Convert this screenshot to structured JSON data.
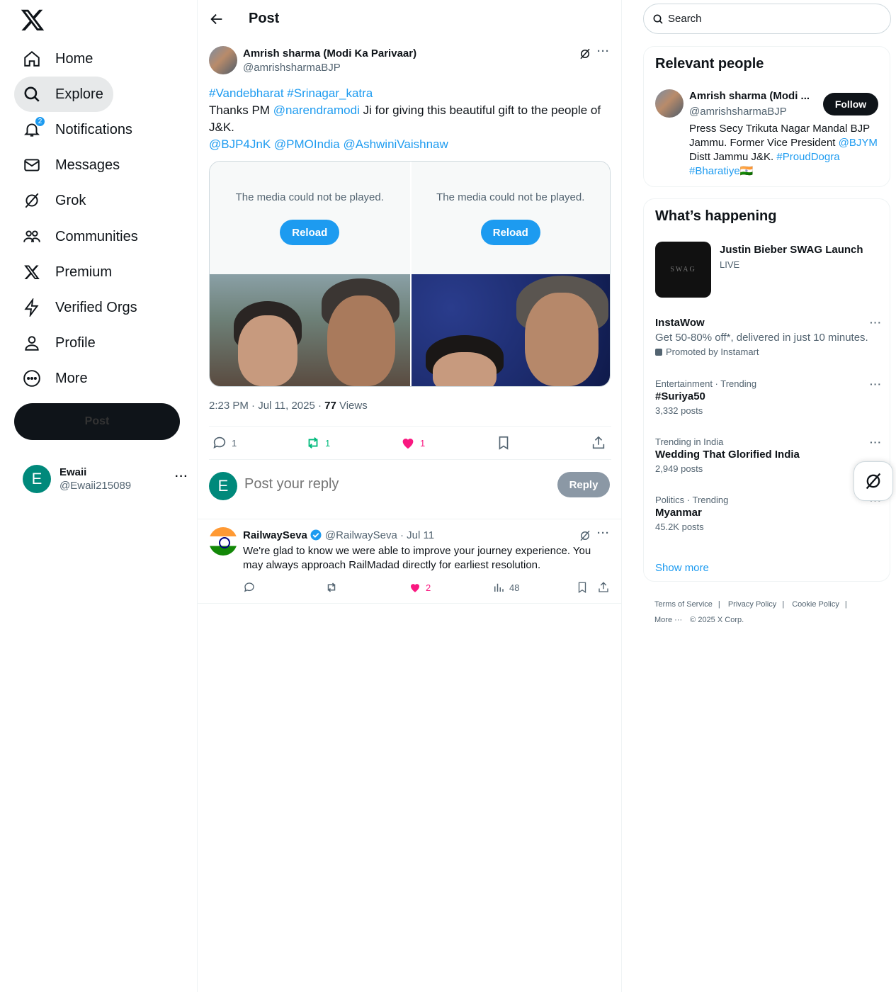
{
  "nav": {
    "items": [
      {
        "label": "Home",
        "icon": "home-icon"
      },
      {
        "label": "Explore",
        "icon": "search-icon"
      },
      {
        "label": "Notifications",
        "icon": "bell-icon"
      },
      {
        "label": "Messages",
        "icon": "mail-icon"
      },
      {
        "label": "Grok",
        "icon": "grok-icon"
      },
      {
        "label": "Communities",
        "icon": "communities-icon"
      },
      {
        "label": "Premium",
        "icon": "x-icon"
      },
      {
        "label": "Verified Orgs",
        "icon": "lightning-icon"
      },
      {
        "label": "Profile",
        "icon": "person-icon"
      },
      {
        "label": "More",
        "icon": "more-circle-icon"
      }
    ],
    "active": "Explore",
    "notifications_badge": "2",
    "post_button": "Post"
  },
  "account": {
    "initial": "E",
    "name": "Ewaii",
    "handle": "@Ewaii215089",
    "more": "···"
  },
  "main": {
    "title": "Post",
    "post": {
      "author_name": "Amrish sharma (Modi Ka Parivaar)",
      "author_handle": "@amrishsharmaBJP",
      "more": "···",
      "hashtags": "#Vandebharat #Srinagar_katra",
      "text_before": "Thanks PM ",
      "mention_pm": "@narendramodi",
      "text_after": " Ji for giving this beautiful gift to the people of J&K.",
      "mentions": "@BJP4JnK @PMOIndia @AshwiniVaishnaw",
      "media": [
        {
          "message": "The media could not be played.",
          "button": "Reload"
        },
        {
          "message": "The media could not be played.",
          "button": "Reload"
        }
      ],
      "time": "2:23 PM · Jul 11, 2025 · ",
      "views_count": "77",
      "views_label": " Views",
      "stats": {
        "replies": "1",
        "reposts": "1",
        "likes": "1"
      }
    },
    "reply_box": {
      "initial": "E",
      "placeholder": "Post your reply",
      "button": "Reply"
    },
    "reply": {
      "name": "RailwaySeva",
      "handle": "@RailwaySeva · Jul 11",
      "more": "···",
      "text": "We're glad to know we were able to improve your journey experience. You may always approach RailMadad directly for earliest resolution.",
      "stats": {
        "likes": "2",
        "views": "48"
      }
    }
  },
  "right": {
    "search_placeholder": "Search",
    "relevant": {
      "title": "Relevant people",
      "name": "Amrish sharma (Modi ...",
      "handle": "@amrishsharmaBJP",
      "follow": "Follow",
      "bio_1": "Press Secy Trikuta Nagar Mandal BJP Jammu. Former Vice President ",
      "bio_link1": "@BJYM",
      "bio_2": " Distt Jammu J&K. ",
      "bio_link2": "#ProudDogra",
      "bio_link3": "#Bharatiye",
      "bio_flag": "🇮🇳"
    },
    "happening": {
      "title": "What’s happening",
      "live_title": "Justin Bieber SWAG Launch",
      "live_label": "LIVE",
      "swag_text": "SWAG",
      "promo_title": "InstaWow",
      "promo_text": "Get 50-80% off*, delivered in just 10 minutes.",
      "promo_by": "Promoted by Instamart",
      "trends": [
        {
          "cat": "Entertainment · Trending",
          "title": "#Suriya50",
          "count": "3,332 posts"
        },
        {
          "cat": "Trending in India",
          "title": "Wedding That Glorified India",
          "count": "2,949 posts"
        },
        {
          "cat": "Politics · Trending",
          "title": "Myanmar",
          "count": "45.2K posts"
        }
      ],
      "show_more": "Show more",
      "more": "···"
    },
    "footer": {
      "links": [
        "Terms of Service",
        "|",
        "Privacy Policy",
        "|",
        "Cookie Policy",
        "|"
      ],
      "more": "More ···",
      "copyright": "© 2025 X Corp."
    }
  }
}
